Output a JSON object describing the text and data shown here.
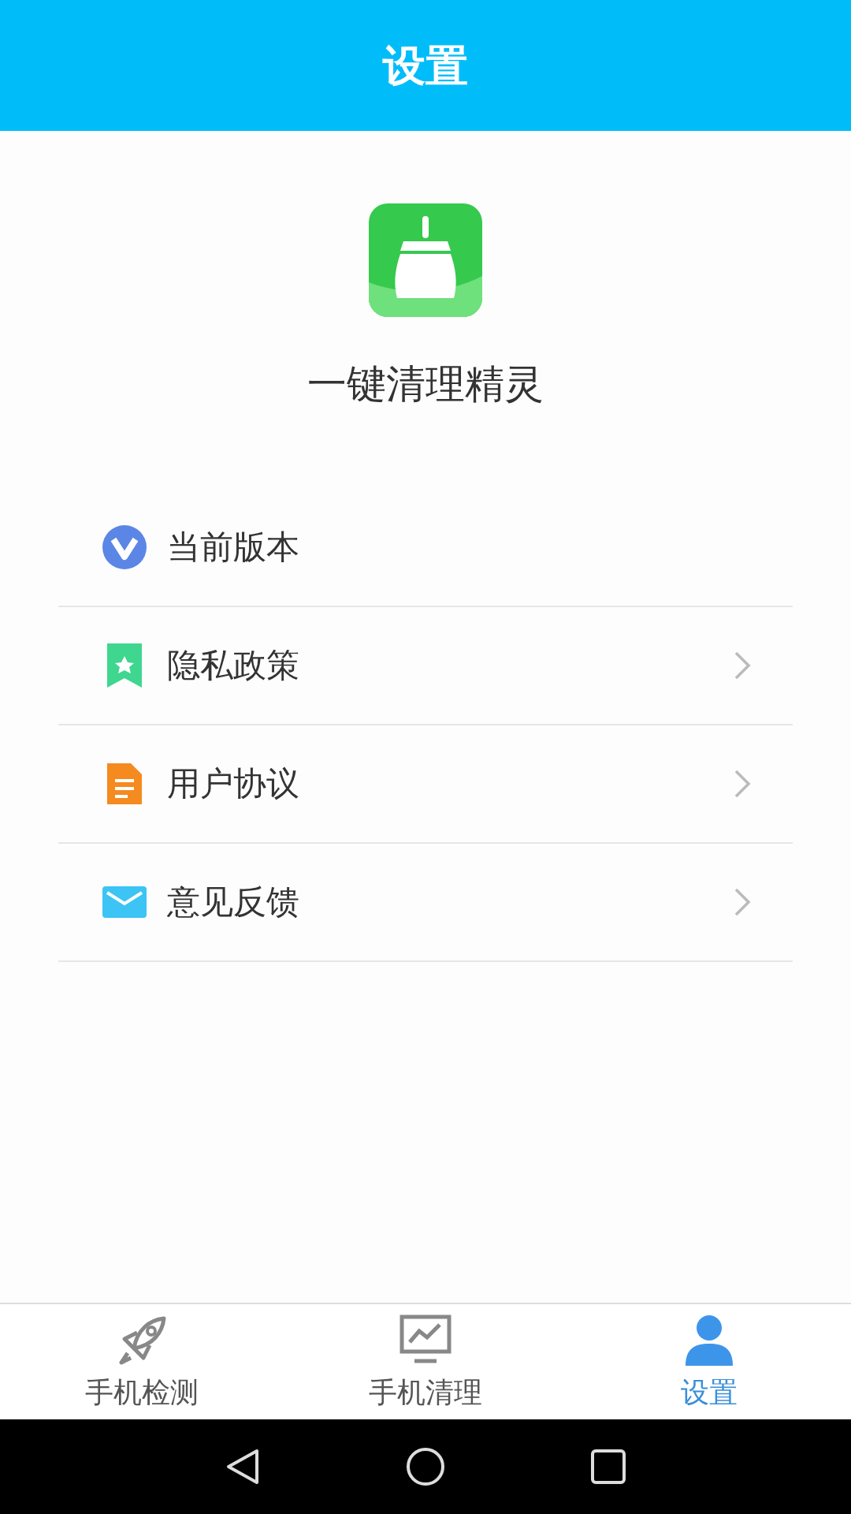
{
  "header": {
    "title": "设置"
  },
  "app": {
    "name": "一键清理精灵"
  },
  "menu": [
    {
      "kind": "version",
      "label": "当前版本",
      "chevron": false
    },
    {
      "kind": "privacy",
      "label": "隐私政策",
      "chevron": true
    },
    {
      "kind": "agreement",
      "label": "用户协议",
      "chevron": true
    },
    {
      "kind": "feedback",
      "label": "意见反馈",
      "chevron": true
    }
  ],
  "tabs": [
    {
      "kind": "rocket",
      "label": "手机检测",
      "selected": false
    },
    {
      "kind": "monitor",
      "label": "手机清理",
      "selected": false
    },
    {
      "kind": "person",
      "label": "设置",
      "selected": true
    }
  ]
}
